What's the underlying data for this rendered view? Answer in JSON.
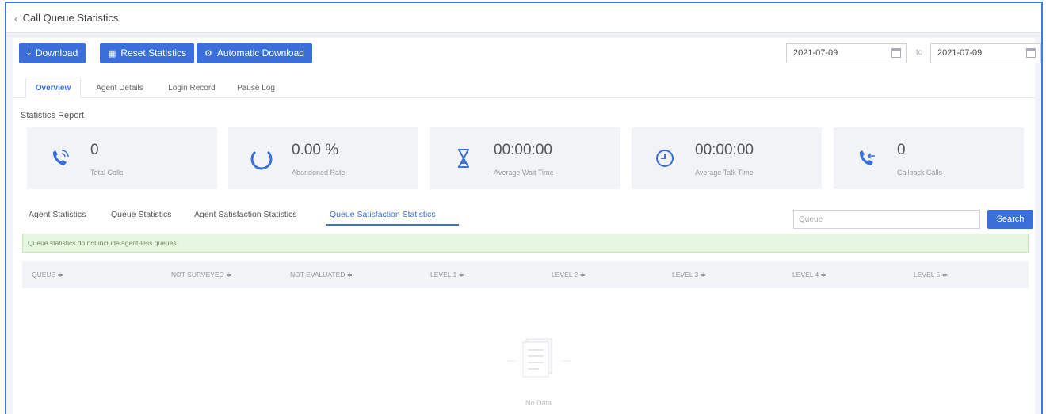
{
  "header": {
    "back_icon": "chevron-left-icon",
    "title": "Call Queue Statistics"
  },
  "toolbar": {
    "download_label": "Download",
    "reset_label": "Reset Statistics",
    "auto_download_label": "Automatic Download",
    "start_date": "2021-07-09",
    "to_label": "to",
    "end_date": "2021-07-09",
    "accent_color": "#3b6fd9"
  },
  "main_tabs": [
    {
      "label": "Overview",
      "active": true
    },
    {
      "label": "Agent Details",
      "active": false
    },
    {
      "label": "Login Record",
      "active": false
    },
    {
      "label": "Pause Log",
      "active": false
    }
  ],
  "report": {
    "title": "Statistics Report",
    "cards": [
      {
        "value": "0",
        "label": "Total Calls",
        "icon": "phone-ringing-icon"
      },
      {
        "value": "0.00 %",
        "label": "Abandoned Rate",
        "icon": "circle-progress-icon"
      },
      {
        "value": "00:00:00",
        "label": "Average Wait Time",
        "icon": "hourglass-icon"
      },
      {
        "value": "00:00:00",
        "label": "Average Talk Time",
        "icon": "clock-icon"
      },
      {
        "value": "0",
        "label": "Callback Calls",
        "icon": "callback-phone-icon"
      }
    ]
  },
  "sub_tabs": [
    {
      "label": "Agent Statistics",
      "active": false
    },
    {
      "label": "Queue Statistics",
      "active": false
    },
    {
      "label": "Agent Satisfaction Statistics",
      "active": false
    },
    {
      "label": "Queue Satisfaction Statistics",
      "active": true
    }
  ],
  "search": {
    "placeholder": "Queue",
    "button_label": "Search"
  },
  "notice": "Queue statistics do not include agent-less queues.",
  "table": {
    "columns": [
      "QUEUE ≑",
      "NOT SURVEYED ≑",
      "NOT EVALUATED ≑",
      "LEVEL 1 ≑",
      "LEVEL 2 ≑",
      "LEVEL 3 ≑",
      "LEVEL 4 ≑",
      "LEVEL 5 ≑"
    ],
    "empty_text": "No Data"
  }
}
